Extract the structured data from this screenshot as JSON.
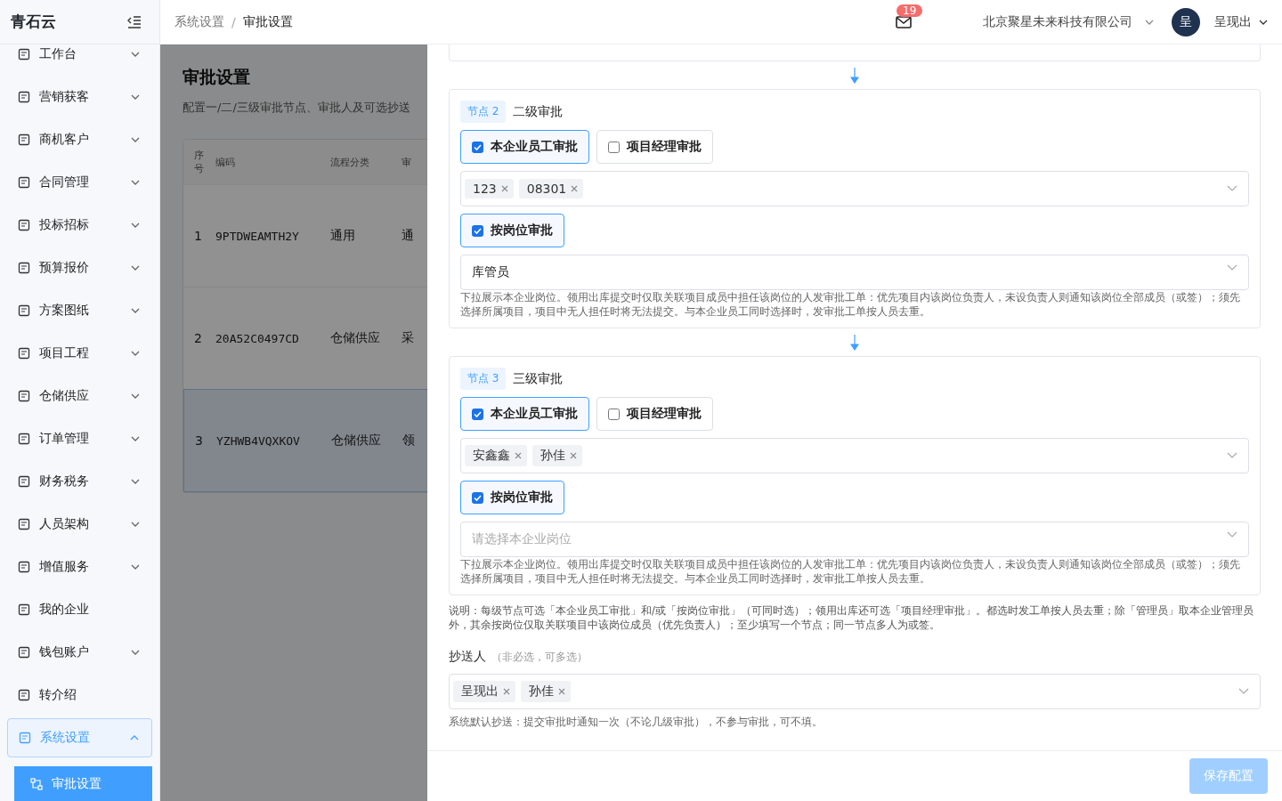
{
  "sidebar": {
    "logo": "青石云",
    "items": [
      {
        "label": "工作台",
        "kind": "group",
        "expanded": false,
        "selected": false
      },
      {
        "label": "营销获客",
        "kind": "group",
        "expanded": false,
        "selected": false
      },
      {
        "label": "商机客户",
        "kind": "group",
        "expanded": false,
        "selected": false
      },
      {
        "label": "合同管理",
        "kind": "group",
        "expanded": false,
        "selected": false
      },
      {
        "label": "投标招标",
        "kind": "group",
        "expanded": false,
        "selected": false
      },
      {
        "label": "预算报价",
        "kind": "group",
        "expanded": false,
        "selected": false
      },
      {
        "label": "方案图纸",
        "kind": "group",
        "expanded": false,
        "selected": false
      },
      {
        "label": "项目工程",
        "kind": "group",
        "expanded": false,
        "selected": false
      },
      {
        "label": "仓储供应",
        "kind": "group",
        "expanded": false,
        "selected": false
      },
      {
        "label": "订单管理",
        "kind": "group",
        "expanded": false,
        "selected": false
      },
      {
        "label": "财务税务",
        "kind": "group",
        "expanded": false,
        "selected": false
      },
      {
        "label": "人员架构",
        "kind": "group",
        "expanded": false,
        "selected": false
      },
      {
        "label": "增值服务",
        "kind": "group",
        "expanded": false,
        "selected": false
      },
      {
        "label": "我的企业",
        "kind": "link",
        "selected": false
      },
      {
        "label": "钱包账户",
        "kind": "group",
        "expanded": false,
        "selected": false
      },
      {
        "label": "转介绍",
        "kind": "link",
        "selected": false
      },
      {
        "label": "系统设置",
        "kind": "group",
        "expanded": true,
        "selected": true,
        "children": [
          {
            "label": "审批设置",
            "selected": true
          }
        ]
      }
    ]
  },
  "header": {
    "breadcrumb": [
      "系统设置",
      "审批设置"
    ],
    "breadcrumb_separator": "/",
    "mail_count": "19",
    "company": "北京聚星未来科技有限公司",
    "avatar": "呈",
    "user": "呈现出"
  },
  "page": {
    "title": "审批设置",
    "subtitle": "配置一/二/三级审批节点、审批人及可选抄送",
    "table": {
      "columns": [
        "序号",
        "编码",
        "流程分类",
        "审"
      ],
      "rows": [
        {
          "cells": [
            "1",
            "9PTDWEAMTH2Y",
            "通用",
            "通"
          ],
          "selected": false
        },
        {
          "cells": [
            "2",
            "20A52C0497CD",
            "仓储供应",
            "采"
          ],
          "selected": false
        },
        {
          "cells": [
            "3",
            "YZHWB4VQXKOV",
            "仓储供应",
            "领"
          ],
          "selected": true
        }
      ]
    }
  },
  "drawer": {
    "nodes": [
      {
        "tag": "节点 2",
        "title": "二级审批",
        "options": [
          {
            "label": "本企业员工审批",
            "checked": true
          },
          {
            "label": "项目经理审批",
            "checked": false
          }
        ],
        "people": [
          "123",
          "08301"
        ],
        "position_option": {
          "label": "按岗位审批",
          "checked": true
        },
        "position": {
          "value": "库管员"
        },
        "hint": "下拉展示本企业岗位。领用出库提交时仅取关联项目成员中担任该岗位的人发审批工单：优先项目内该岗位负责人，未设负责人则通知该岗位全部成员（或签）；须先选择所属项目，项目中无人担任时将无法提交。与本企业员工同时选择时，发审批工单按人员去重。"
      },
      {
        "tag": "节点 3",
        "title": "三级审批",
        "options": [
          {
            "label": "本企业员工审批",
            "checked": true
          },
          {
            "label": "项目经理审批",
            "checked": false
          }
        ],
        "people": [
          "安鑫鑫",
          "孙佳"
        ],
        "position_option": {
          "label": "按岗位审批",
          "checked": true
        },
        "position": {
          "placeholder": "请选择本企业岗位"
        },
        "hint": "下拉展示本企业岗位。领用出库提交时仅取关联项目成员中担任该岗位的人发审批工单：优先项目内该岗位负责人，未设负责人则通知该岗位全部成员（或签）；须先选择所属项目，项目中无人担任时将无法提交。与本企业员工同时选择时，发审批工单按人员去重。"
      }
    ],
    "note": "说明：每级节点可选「本企业员工审批」和/或「按岗位审批」（可同时选）；领用出库还可选「项目经理审批」。都选时发工单按人员去重；除「管理员」取本企业管理员外，其余按岗位仅取关联项目中该岗位成员（优先负责人）；至少填写一个节点；同一节点多人为或签。",
    "cc": {
      "label": "抄送人",
      "sublabel": "（非必选，可多选）",
      "people": [
        "呈现出",
        "孙佳"
      ],
      "hint": "系统默认抄送：提交审批时通知一次（不论几级审批），不参与审批，可不填。"
    },
    "save": {
      "label": "保存配置",
      "disabled": true
    }
  }
}
